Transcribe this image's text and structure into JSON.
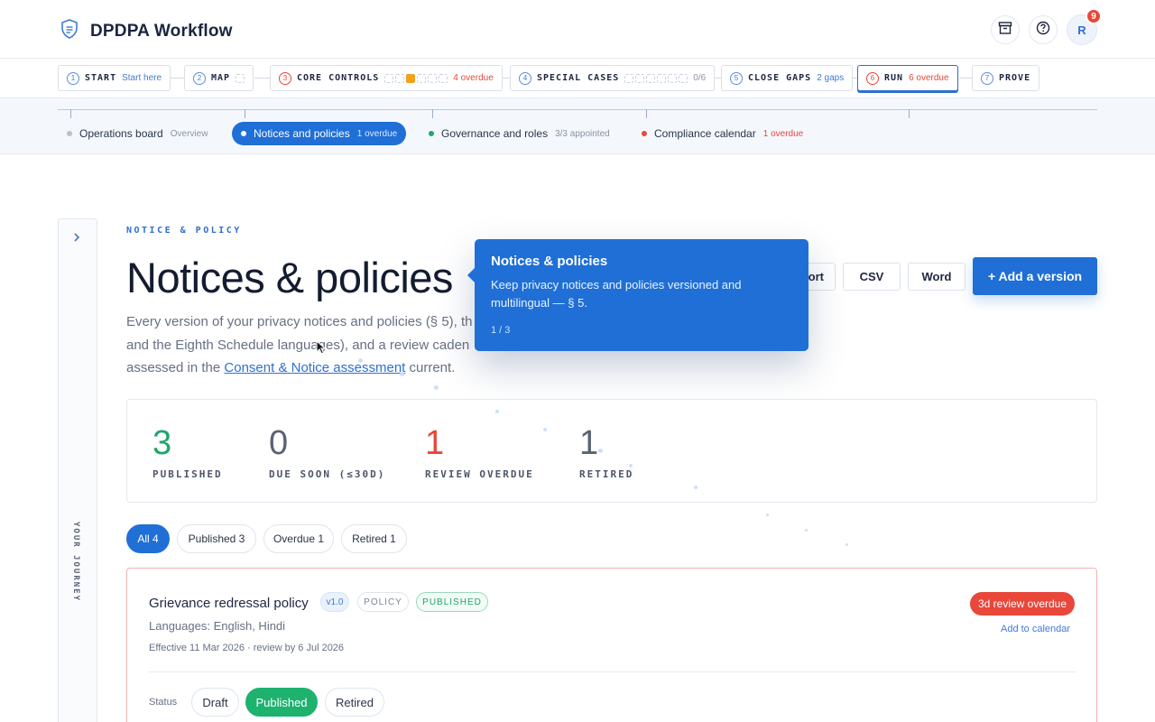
{
  "header": {
    "app_title": "DPDPA Workflow",
    "notification_count": "9",
    "avatar_initial": "R"
  },
  "stepper": [
    {
      "num": "1",
      "label": "START",
      "sub": "Start here"
    },
    {
      "num": "2",
      "label": "MAP",
      "sub": ""
    },
    {
      "num": "3",
      "label": "CORE CONTROLS",
      "sub": "4 overdue"
    },
    {
      "num": "4",
      "label": "SPECIAL CASES",
      "sub": "0/6"
    },
    {
      "num": "5",
      "label": "CLOSE GAPS",
      "sub": "2 gaps"
    },
    {
      "num": "6",
      "label": "RUN",
      "sub": "6 overdue"
    },
    {
      "num": "7",
      "label": "PROVE",
      "sub": ""
    }
  ],
  "subnav": [
    {
      "label": "Operations board",
      "meta": "Overview"
    },
    {
      "label": "Notices and policies",
      "meta": "1 overdue"
    },
    {
      "label": "Governance and roles",
      "meta": "3/3 appointed"
    },
    {
      "label": "Compliance calendar",
      "meta": "1 overdue"
    }
  ],
  "journey": {
    "label": "YOUR JOURNEY"
  },
  "main": {
    "eyebrow": "NOTICE & POLICY",
    "title": "Notices & policies",
    "desc_part1": "Every version of your privacy notices and policies (§ 5), th",
    "desc_part2": "and the Eighth Schedule languages), and a review caden",
    "desc_part3": "assessed in the ",
    "desc_link": "Consent & Notice assessment",
    "desc_part4": " current.",
    "export_partial": "ort",
    "csv_label": "CSV",
    "word_label": "Word",
    "add_label": "+ Add a version"
  },
  "stats": [
    {
      "value": "3",
      "label": "PUBLISHED",
      "color": "#1ea76b"
    },
    {
      "value": "0",
      "label": "DUE SOON (≤30D)",
      "color": "#5a6374"
    },
    {
      "value": "1",
      "label": "REVIEW OVERDUE",
      "color": "#e8473a"
    },
    {
      "value": "1",
      "label": "RETIRED",
      "color": "#5a6374"
    }
  ],
  "filters": [
    {
      "label": "All 4"
    },
    {
      "label": "Published 3"
    },
    {
      "label": "Overdue 1"
    },
    {
      "label": "Retired 1"
    }
  ],
  "policy": {
    "title": "Grievance redressal policy",
    "version": "v1.0",
    "kind": "POLICY",
    "state": "PUBLISHED",
    "languages": "Languages: English, Hindi",
    "effective": "Effective 11 Mar 2026 · review by 6 Jul 2026",
    "overdue": "3d review overdue",
    "calendar_link": "Add to calendar",
    "status_label": "Status",
    "status_options": [
      "Draft",
      "Published",
      "Retired"
    ]
  },
  "tooltip": {
    "title": "Notices & policies",
    "body": "Keep privacy notices and policies versioned and multilingual — § 5.",
    "step": "1 / 3"
  },
  "icons": {
    "brand": "shield-icon",
    "archive": "archive-icon",
    "help": "help-icon",
    "journey_toggle": "chevron-right-icon"
  },
  "colors": {
    "accent": "#1f6fd6",
    "success": "#1ea76b",
    "danger": "#e8473a",
    "warning": "#f2a11b"
  }
}
